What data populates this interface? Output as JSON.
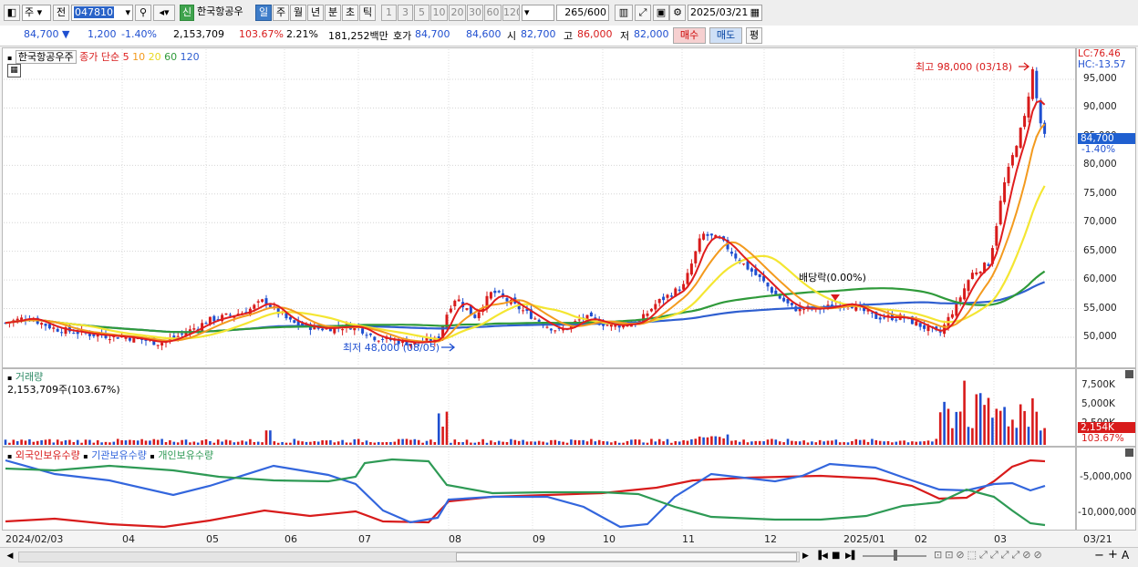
{
  "toolbar": {
    "type_sel": "주",
    "nav_label": "전",
    "code": "047810",
    "name": "한국항공우",
    "periods": [
      "일",
      "주",
      "월",
      "년",
      "분",
      "초",
      "틱"
    ],
    "selected_period": "일",
    "numbers": [
      "1",
      "3",
      "5",
      "10",
      "20",
      "30",
      "60",
      "120"
    ],
    "count": "265",
    "count_max": "/600",
    "date": "2025/03/21",
    "new_badge": "신"
  },
  "quote": {
    "price": "84,700",
    "change": "1,200",
    "change_pct": "-1.40%",
    "volume": "2,153,709",
    "vol_ratio": "103.67%",
    "turnover": "2.21%",
    "amount": "181,252백만",
    "bid_label": "호가",
    "ask": "84,700",
    "bid": "84,600",
    "open_label": "시",
    "open": "82,700",
    "high_label": "고",
    "high": "86,000",
    "low_label": "저",
    "low": "82,000",
    "buy_button": "매수",
    "sell_button": "매도",
    "eval_button": "평"
  },
  "price_panel": {
    "stock_name": "한국항공우주",
    "legend_type": "종가 단순",
    "ma_labels": [
      "5",
      "10",
      "20",
      "60",
      "120"
    ],
    "lc_label": "LC:76.46",
    "hc_label": "HC:-13.57",
    "current_price": "84,700",
    "current_change": "-1.40%",
    "max_annotation": "최고 98,000 (03/18)",
    "min_annotation": "최저 48,000 (08/05)",
    "dividend_annotation": "배당락(0.00%)",
    "y_ticks": [
      "95,000",
      "90,000",
      "85,000",
      "80,000",
      "75,000",
      "70,000",
      "65,000",
      "60,000",
      "55,000",
      "50,000"
    ]
  },
  "volume_panel": {
    "title": "거래량",
    "value": "2,153,709주(103.67%)",
    "y_ticks": [
      "7,500K",
      "5,000K",
      "2,500K"
    ],
    "current": "2,154K",
    "current_pct": "103.67%"
  },
  "holding_panel": {
    "series": [
      "외국인보유수량",
      "기관보유수량",
      "개인보유수량"
    ],
    "y_ticks": [
      "-5,000,000",
      "-10,000,000"
    ]
  },
  "x_axis": {
    "labels": [
      "2024/02/03",
      "04",
      "05",
      "06",
      "07",
      "08",
      "09",
      "10",
      "11",
      "12",
      "2025/01",
      "02",
      "03",
      "03/21"
    ]
  },
  "colors": {
    "up": "#d81b1b",
    "down": "#1f4fd0",
    "ma5": "#e01e1e",
    "ma10": "#f39a1e",
    "ma20": "#f4e632",
    "ma60": "#2f9a3a",
    "ma120": "#2f5fd0",
    "foreign": "#d81b1b",
    "institution": "#3366dd",
    "individual": "#2e9a55"
  },
  "chart_data": {
    "type": "candlestick",
    "title": "한국항공우주",
    "x": [
      "2024/02",
      "2024/03",
      "2024/04",
      "2024/05",
      "2024/06",
      "2024/07",
      "2024/08",
      "2024/09",
      "2024/10",
      "2024/11",
      "2024/12",
      "2025/01",
      "2025/02",
      "2025/03/21"
    ],
    "series": [
      {
        "name": "종가",
        "values": [
          53000,
          51000,
          49500,
          53500,
          57000,
          51500,
          52000,
          53500,
          52000,
          69000,
          55000,
          54000,
          52000,
          84700
        ]
      },
      {
        "name": "거래량",
        "values": [
          400000,
          450000,
          380000,
          500000,
          1800000,
          500000,
          3300000,
          800000,
          600000,
          1500000,
          900000,
          700000,
          1000000,
          2153709
        ]
      }
    ],
    "ylim": [
      47000,
      99000
    ],
    "max": {
      "value": 98000,
      "date": "03/18"
    },
    "min": {
      "value": 48000,
      "date": "08/05"
    }
  }
}
